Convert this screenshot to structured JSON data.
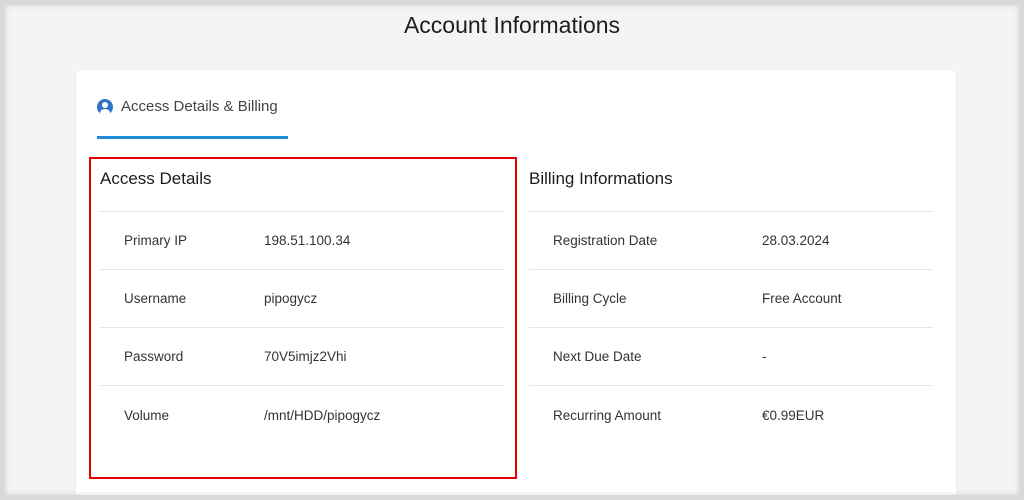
{
  "page": {
    "title": "Account Informations"
  },
  "tabs": [
    {
      "label": "Access Details & Billing",
      "icon": "user-circle-icon",
      "active": true
    }
  ],
  "colors": {
    "accent": "#1f8ad8",
    "icon": "#2f73c6",
    "highlight": "#e00000"
  },
  "access": {
    "title": "Access Details",
    "rows": [
      {
        "label": "Primary IP",
        "value": "198.51.100.34"
      },
      {
        "label": "Username",
        "value": "pipogycz"
      },
      {
        "label": "Password",
        "value": "70V5imjz2Vhi"
      },
      {
        "label": "Volume",
        "value": "/mnt/HDD/pipogycz"
      }
    ]
  },
  "billing": {
    "title": "Billing Informations",
    "rows": [
      {
        "label": "Registration Date",
        "value": "28.03.2024"
      },
      {
        "label": "Billing Cycle",
        "value": "Free Account"
      },
      {
        "label": "Next Due Date",
        "value": "-"
      },
      {
        "label": "Recurring Amount",
        "value": "€0.99EUR"
      }
    ]
  }
}
